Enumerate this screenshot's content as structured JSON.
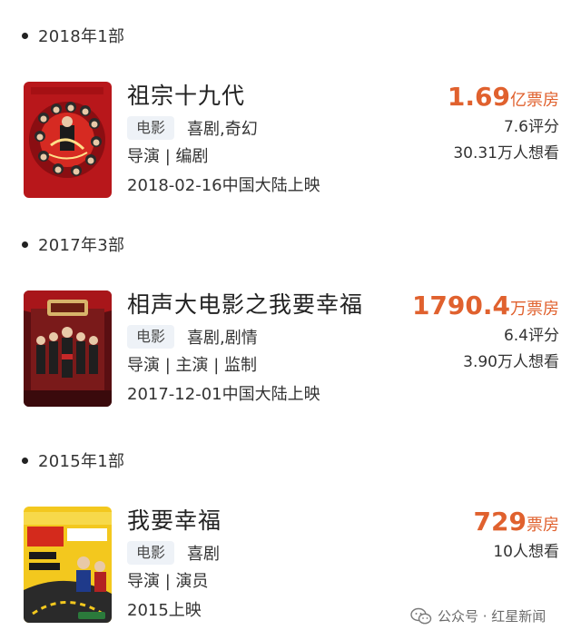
{
  "sections": [
    {
      "year": "2018年1部",
      "movie": {
        "title": "祖宗十九代",
        "tag": "电影",
        "genre": "喜剧,奇幻",
        "roles": "导演 | 编剧",
        "release": "2018-02-16中国大陆上映",
        "box_number": "1.69",
        "box_unit": "亿票房",
        "score": "7.6评分",
        "want": "30.31万人想看"
      }
    },
    {
      "year": "2017年3部",
      "movie": {
        "title": "相声大电影之我要幸福",
        "tag": "电影",
        "genre": "喜剧,剧情",
        "roles": "导演 | 主演 | 监制",
        "release": "2017-12-01中国大陆上映",
        "box_number": "1790.4",
        "box_unit": "万票房",
        "score": "6.4评分",
        "want": "3.90万人想看"
      }
    },
    {
      "year": "2015年1部",
      "movie": {
        "title": "我要幸福",
        "tag": "电影",
        "genre": "喜剧",
        "roles": "导演 | 演员",
        "release": "2015上映",
        "box_number": "729",
        "box_unit": "票房",
        "want": "10人想看"
      }
    }
  ],
  "watermark": {
    "text": "公众号 · 红星新闻",
    "icon": "wechat-icon"
  },
  "colors": {
    "accent": "#e0612e",
    "tag_bg": "#eef2f7"
  }
}
